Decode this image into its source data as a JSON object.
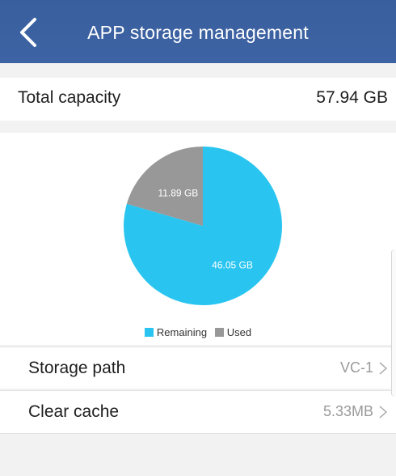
{
  "header": {
    "title": "APP storage management",
    "back_icon": "chevron-left-icon"
  },
  "total": {
    "label": "Total capacity",
    "value": "57.94 GB"
  },
  "chart_data": {
    "type": "pie",
    "slices": [
      {
        "name": "Remaining",
        "value": 46.05,
        "label": "46.05 GB",
        "color": "#29c5f0"
      },
      {
        "name": "Used",
        "value": 11.89,
        "label": "11.89 GB",
        "color": "#989898"
      }
    ],
    "legend": [
      "Remaining",
      "Used"
    ],
    "legend_position": "bottom"
  },
  "rows": [
    {
      "label": "Storage path",
      "value": "VC-1",
      "icon": "chevron-right-icon"
    },
    {
      "label": "Clear cache",
      "value": "5.33MB",
      "icon": "chevron-right-icon"
    }
  ],
  "colors": {
    "header": "#3d62a3",
    "remaining": "#29c5f0",
    "used": "#989898",
    "background": "#f2f2f2"
  }
}
